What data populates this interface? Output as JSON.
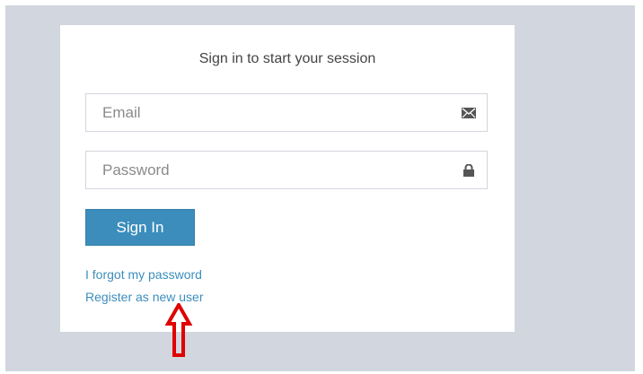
{
  "login": {
    "message": "Sign in to start your session",
    "email_placeholder": "Email",
    "password_placeholder": "Password",
    "sign_in_label": "Sign In",
    "forgot_password_label": "I forgot my password",
    "register_label": "Register as new user"
  },
  "icons": {
    "email_field": "envelope-icon",
    "password_field": "lock-icon",
    "annotation": "up-arrow-icon"
  },
  "colors": {
    "page_background": "#d2d6de",
    "box_background": "#ffffff",
    "primary_button": "#3c8dbc",
    "link": "#3c8dbc",
    "annotation_arrow": "#e00000"
  }
}
